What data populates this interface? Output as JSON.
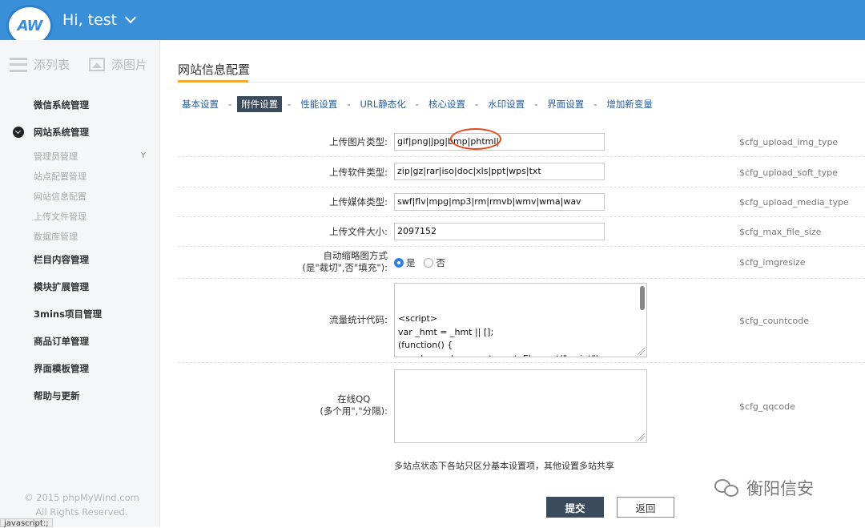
{
  "header": {
    "greeting": "Hi, test",
    "logo_text": "AW"
  },
  "sidebar": {
    "top": [
      {
        "label": "添列表",
        "icon": "list-icon"
      },
      {
        "label": "添图片",
        "icon": "image-icon"
      }
    ],
    "menu": [
      {
        "label": "微信系统管理"
      },
      {
        "label": "网站系统管理"
      },
      {
        "label": "栏目内容管理"
      },
      {
        "label": "模块扩展管理"
      },
      {
        "label": "3mins项目管理"
      },
      {
        "label": "商品订单管理"
      },
      {
        "label": "界面模板管理"
      },
      {
        "label": "帮助与更新"
      }
    ],
    "submenu": [
      {
        "label": "管理员管理",
        "mark": "Y"
      },
      {
        "label": "站点配置管理"
      },
      {
        "label": "网站信息配置"
      },
      {
        "label": "上传文件管理"
      },
      {
        "label": "数据库管理"
      }
    ],
    "copyright_line1": "© 2015 phpMyWind.com",
    "copyright_line2": "All Rights Reserved."
  },
  "status_bar": "javascript:;",
  "page": {
    "title": "网站信息配置"
  },
  "tabs": [
    "基本设置",
    "附件设置",
    "性能设置",
    "URL静态化",
    "核心设置",
    "水印设置",
    "界面设置",
    "增加新变量"
  ],
  "active_tab": "附件设置",
  "tab_separator": "-",
  "fields": {
    "img_type": {
      "label": "上传图片类型:",
      "value": "gif|png|jpg|bmp|phtml|",
      "var": "$cfg_upload_img_type"
    },
    "soft_type": {
      "label": "上传软件类型:",
      "value": "zip|gz|rar|iso|doc|xls|ppt|wps|txt",
      "var": "$cfg_upload_soft_type"
    },
    "media_type": {
      "label": "上传媒体类型:",
      "value": "swf|flv|mpg|mp3|rm|rmvb|wmv|wma|wav",
      "var": "$cfg_upload_media_type"
    },
    "max_size": {
      "label": "上传文件大小:",
      "value": "2097152",
      "var": "$cfg_max_file_size"
    },
    "imgresize": {
      "label1": "自动缩略图方式",
      "label2": "(是\"裁切\",否\"填充\"):",
      "yes": "是",
      "no": "否",
      "selected": "yes",
      "var": "$cfg_imgresize"
    },
    "countcode": {
      "label": "流量统计代码:",
      "value": "<script>\nvar _hmt = _hmt || [];\n(function() {\n  var hm = document.createElement(\"script\");\n  hm.src = \"https://hm.baidu.com",
      "var": "$cfg_countcode"
    },
    "qqcode": {
      "label1": "在线QQ",
      "label2": "(多个用\",\"分隔):",
      "value": "",
      "var": "$cfg_qqcode"
    }
  },
  "note": "多站点状态下各站只区分基本设置项，其他设置多站共享",
  "buttons": {
    "submit": "提交",
    "back": "返回"
  },
  "watermark": "衡阳信安"
}
